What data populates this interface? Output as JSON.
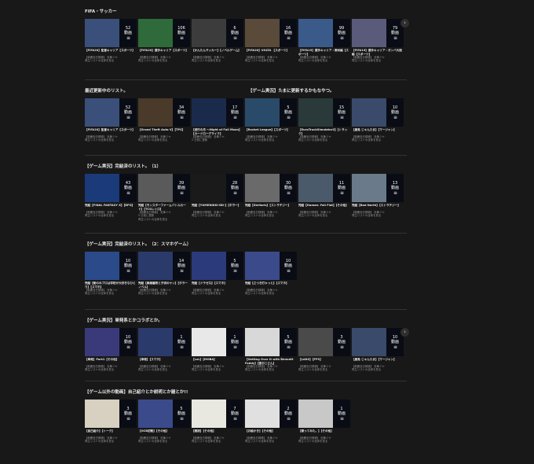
{
  "sections": [
    {
      "title": "FIFA・サッカー",
      "cards": [
        {
          "count": "52",
          "unit": "動画",
          "title": "【FIFA20】監督キャリア【スポーツ】",
          "meta": [
            "【新鹿島日録帳】 杜隼ミヤ",
            "再生リストの全体を見る"
          ],
          "art": "#3a4f7a"
        },
        {
          "count": "106",
          "unit": "動画",
          "title": "【FIFA20】選手キャリア【スポーツ】",
          "meta": [
            "【新鹿島日録帳】 杜隼ミヤ",
            "再生リストの全体を見る"
          ],
          "art": "#2f6a3a"
        },
        {
          "count": "6",
          "unit": "動画",
          "title": "【かんたんサッカー】【ノベルゲーム】",
          "meta": [
            "【新鹿島日録帳】 杜隼ミヤ",
            "再生リストの全体を見る"
          ],
          "art": "#3c3c3c"
        },
        {
          "count": "16",
          "unit": "動画",
          "title": "【FIFA20】VOLTA 【スポーツ】",
          "meta": [
            "【新鹿島日録帳】 杜隼ミヤ",
            "再生リストの全体を見る"
          ],
          "art": "#5a4a3a"
        },
        {
          "count": "99",
          "unit": "動画",
          "title": "【FIFA19】選手キャリア・南米編【スポーツ】",
          "meta": [
            "【新鹿島日録帳】 杜隼ミヤ",
            "再生リストの全体を見る"
          ],
          "art": "#3a5a8a"
        },
        {
          "count": "79",
          "unit": "動画",
          "title": "【FIFA19】選手キャリア・ガンバ大阪編【スポーツ】",
          "meta": [
            "【新鹿島日録帳】 杜隼ミヤ",
            "再生リストの全体を見る"
          ],
          "art": "#5a5a7a"
        }
      ]
    },
    {
      "title": "最近更新中のリスト。",
      "cards": [
        {
          "count": "52",
          "unit": "動画",
          "title": "【FIFA20】監督キャリア【スポーツ】",
          "meta": [
            "【新鹿島日録帳】 杜隼ミヤ",
            "再生リストの全体を見る"
          ],
          "art": "#3a4f7a"
        },
        {
          "count": "34",
          "unit": "動画",
          "title": "【Grand Theft Auto V】【TPS】",
          "meta": [
            "【新鹿島日録帳】 杜隼ミヤ",
            "再生リストの全体を見る"
          ],
          "art": "#4a3a2a"
        },
        {
          "count": "17",
          "unit": "動画",
          "title": "【送行の月 ～Night of Full Moon】【カードローグライク】",
          "meta": [
            "【新鹿島日録帳】 杜隼ミヤ",
            "2 日前に更新"
          ],
          "art": "#1a2a4a"
        },
        {
          "count": "5",
          "unit": "動画",
          "title": "【Rocket League】【スポーツ】",
          "meta": [
            "【新鹿島日録帳】 杜隼ミヤ",
            "再生リストの全体を見る"
          ],
          "art": "#2a4a6a"
        },
        {
          "count": "15",
          "unit": "動画",
          "title": "【EuroTruckSimulator2】【トラック】",
          "meta": [
            "【新鹿島日録帳】 杜隼ミヤ",
            "再生リストの全体を見る"
          ],
          "art": "#2a3a3a"
        },
        {
          "count": "10",
          "unit": "動画",
          "title": "【鹿島 じゃんたま】【マージャン】",
          "meta": [
            "【新鹿島日録帳】 杜隼ミヤ",
            "再生リストの全体を見る"
          ],
          "art": "#3a4a6a"
        }
      ],
      "right_title": "【ゲーム実況】たまに更新するかもなやつ。"
    },
    {
      "title": "【ゲーム実況】完結済のリスト。（1）",
      "cards": [
        {
          "count": "43",
          "unit": "動画",
          "title": "完結【FINAL FANTASY X】【RPG】",
          "meta": [
            "【新鹿島日録帳】 杜隼ミヤ",
            "再生リストの全体を見る"
          ],
          "art": "#1a3a7a"
        },
        {
          "count": "39",
          "unit": "動画",
          "title": "完結【モンスターファームバトルカード】【TCGレトロ】",
          "meta": [
            "【新鹿島日録帳】 杜隼ミヤ",
            "5 日前に更新",
            "再生リストの全体を見る"
          ],
          "art": "#5a5a5a"
        },
        {
          "count": "28",
          "unit": "動画",
          "title": "完結【YUMENIKKI-DD-】【ホラー】",
          "meta": [
            "【新鹿島日録帳】 杜隼ミヤ",
            "再生リストの全体を見る"
          ],
          "art": "#1a1a1a"
        },
        {
          "count": "30",
          "unit": "動画",
          "title": "完結【Stellaris】【ストラテジー】",
          "meta": [
            "【新鹿島日録帳】 杜隼ミヤ",
            "再生リストの全体を見る"
          ],
          "art": "#6a6a6a"
        },
        {
          "count": "11",
          "unit": "動画",
          "title": "完結【Human: Fall Flat】【その他】",
          "meta": [
            "【新鹿島日録帳】 杜隼ミヤ",
            "再生リストの全体を見る"
          ],
          "art": "#4a5a6a"
        },
        {
          "count": "13",
          "unit": "動画",
          "title": "完結【Bad North】【ストラテジー】",
          "meta": [
            "【新鹿島日録帳】 杜隼ミヤ",
            "再生リストの全体を見る"
          ],
          "art": "#6a7a8a"
        }
      ]
    },
    {
      "title": "【ゲーム実況】完結済のリスト。（2：スマホゲーム）",
      "cards": [
        {
          "count": "10",
          "unit": "動画",
          "title": "完結【動のみプロは学校が大好きなひとり】【スマホ】",
          "meta": [
            "【新鹿島日録帳】 杜隼ミヤ",
            "再生リストの全体を見る"
          ],
          "art": "#2a4a8a"
        },
        {
          "count": "14",
          "unit": "動画",
          "title": "完結【異端審問と子供のヤン】【ホラーノベル】",
          "meta": [
            "【新鹿島日録帳】 杜隼ミヤ",
            "再生リストの全体を見る"
          ],
          "art": "#2a3a6a"
        },
        {
          "count": "5",
          "unit": "動画",
          "title": "完結【ドラゼロ】【スマホ】",
          "meta": [
            "【新鹿島日録帳】 杜隼ミヤ",
            "再生リストの全体を見る"
          ],
          "art": "#2a3a7a"
        },
        {
          "count": "10",
          "unit": "動画",
          "title": "完結【さつき打ゃっと】【スマホ】",
          "meta": [
            "【新鹿島日録帳】 杜隼ミヤ",
            "再生リストの全体を見る"
          ],
          "art": "#3a4a8a"
        }
      ]
    },
    {
      "title": "【ゲーム実況】単発系とかコラボとか。",
      "cards": [
        {
          "count": "10",
          "unit": "動画",
          "title": "【単発】Part1【その他】",
          "meta": [
            "【新鹿島日録帳】 杜隼ミヤ",
            "再生リストの全体を見る"
          ],
          "art": "#3a3a7a"
        },
        {
          "count": "1",
          "unit": "動画",
          "title": "【単発】【スマホ】",
          "meta": [
            "【新鹿島日録帳】 杜隼ミヤ",
            "再生リストの全体を見る"
          ],
          "art": "#2a3a6a"
        },
        {
          "count": "1",
          "unit": "動画",
          "title": "【LoL】【MOBA】",
          "meta": [
            "【新鹿島日録帳】 杜隼ミヤ",
            "再生リストの全体を見る"
          ],
          "art": "#e8e8e8"
        },
        {
          "count": "5",
          "unit": "動画",
          "title": "【Getting Over It with Bennett Foddy】【壺おじさん】",
          "meta": [
            "【新鹿島日録帳】 杜隼ミヤ",
            "再生リストの全体を見る"
          ],
          "art": "#d8d8d8"
        },
        {
          "count": "3",
          "unit": "動画",
          "title": "【LAD2】【FPS】",
          "meta": [
            "【新鹿島日録帳】 杜隼ミヤ",
            "再生リストの全体を見る"
          ],
          "art": "#4a4a4a"
        },
        {
          "count": "10",
          "unit": "動画",
          "title": "【鹿島 じゃんたま】【マージャン】",
          "meta": [
            "【新鹿島日録帳】 杜隼ミヤ",
            "再生リストの全体を見る"
          ],
          "art": "#3a4a6a"
        }
      ]
    },
    {
      "title": "【ゲーム以外の動画】自己紹介とか説明とか雑とか!!",
      "cards": [
        {
          "count": "3",
          "unit": "動画",
          "title": "【自己紹介】【トーク】",
          "meta": [
            "【新鹿島日録帳】 杜隼ミヤ",
            "再生リストの全体を見る"
          ],
          "art": "#d8d0c0"
        },
        {
          "count": "5",
          "unit": "動画",
          "title": "【OCB初動】【その他】",
          "meta": [
            "【新鹿島日録帳】 杜隼ミヤ",
            "再生リストの全体を見る"
          ],
          "art": "#3a4a8a"
        },
        {
          "count": "7",
          "unit": "動画",
          "title": "【朗読】【その他】",
          "meta": [
            "【新鹿島日録帳】 杜隼ミヤ",
            "再生リストの全体を見る"
          ],
          "art": "#e8e8e0"
        },
        {
          "count": "2",
          "unit": "動画",
          "title": "【お絵かき】【その他】",
          "meta": [
            "【新鹿島日録帳】 杜隼ミヤ",
            "再生リストの全体を見る"
          ],
          "art": "#e0e0e0"
        },
        {
          "count": "1",
          "unit": "動画",
          "title": "【歌ってみた。】【その他】",
          "meta": [
            "【新鹿島日録帳】 杜隼ミヤ",
            "再生リストの全体を見る"
          ],
          "art": "#c8c8c8"
        }
      ]
    }
  ],
  "next_arrow": "›"
}
